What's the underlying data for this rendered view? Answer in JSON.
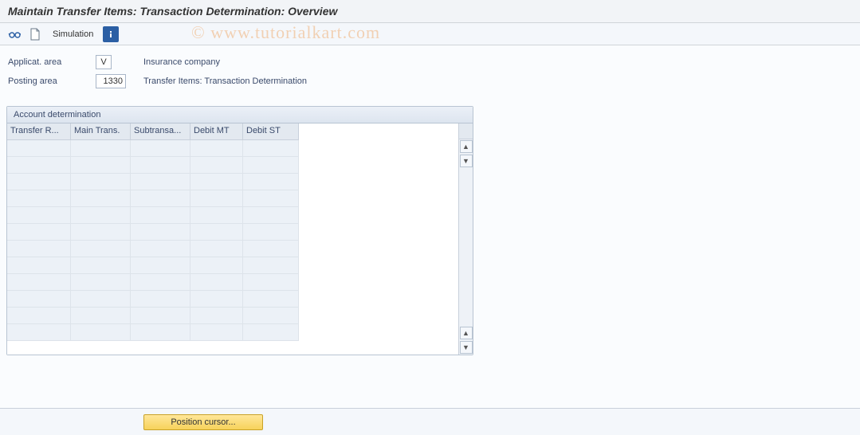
{
  "window": {
    "title": "Maintain Transfer Items: Transaction Determination: Overview"
  },
  "toolbar": {
    "simulation_label": "Simulation"
  },
  "form": {
    "applicat_area_label": "Applicat. area",
    "applicat_area_value": "V",
    "applicat_area_desc": "Insurance company",
    "posting_area_label": "Posting area",
    "posting_area_value": "1330",
    "posting_area_desc": "Transfer Items: Transaction Determination"
  },
  "panel": {
    "title": "Account determination",
    "columns": [
      "Transfer R...",
      "Main Trans.",
      "Subtransa...",
      "Debit MT",
      "Debit ST"
    ],
    "rows": [
      [
        "",
        "",
        "",
        "",
        ""
      ],
      [
        "",
        "",
        "",
        "",
        ""
      ],
      [
        "",
        "",
        "",
        "",
        ""
      ],
      [
        "",
        "",
        "",
        "",
        ""
      ],
      [
        "",
        "",
        "",
        "",
        ""
      ],
      [
        "",
        "",
        "",
        "",
        ""
      ],
      [
        "",
        "",
        "",
        "",
        ""
      ],
      [
        "",
        "",
        "",
        "",
        ""
      ],
      [
        "",
        "",
        "",
        "",
        ""
      ],
      [
        "",
        "",
        "",
        "",
        ""
      ],
      [
        "",
        "",
        "",
        "",
        ""
      ],
      [
        "",
        "",
        "",
        "",
        ""
      ]
    ]
  },
  "footer": {
    "position_cursor_label": "Position cursor..."
  },
  "watermark": "© www.tutorialkart.com"
}
